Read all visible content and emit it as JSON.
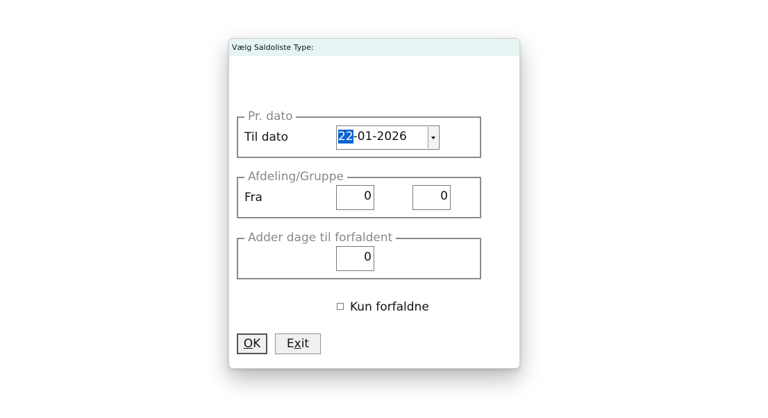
{
  "dialog": {
    "title": "Vælg Saldoliste Type:"
  },
  "group_date": {
    "legend": "Pr. dato",
    "label": "Til dato",
    "date_selected_part": "22",
    "date_rest": "-01-2026"
  },
  "group_department": {
    "legend": "Afdeling/Gruppe",
    "label": "Fra",
    "from_value": "0",
    "to_value": "0"
  },
  "group_days": {
    "legend": "Adder dage til forfaldent",
    "value": "0"
  },
  "checkbox": {
    "label": "Kun forfaldne",
    "checked": false
  },
  "buttons": {
    "ok_accel": "O",
    "ok_rest": "K",
    "exit_first": "E",
    "exit_accel": "x",
    "exit_rest": "it"
  },
  "icons": {
    "date_dropdown": "chevron-down-icon"
  }
}
